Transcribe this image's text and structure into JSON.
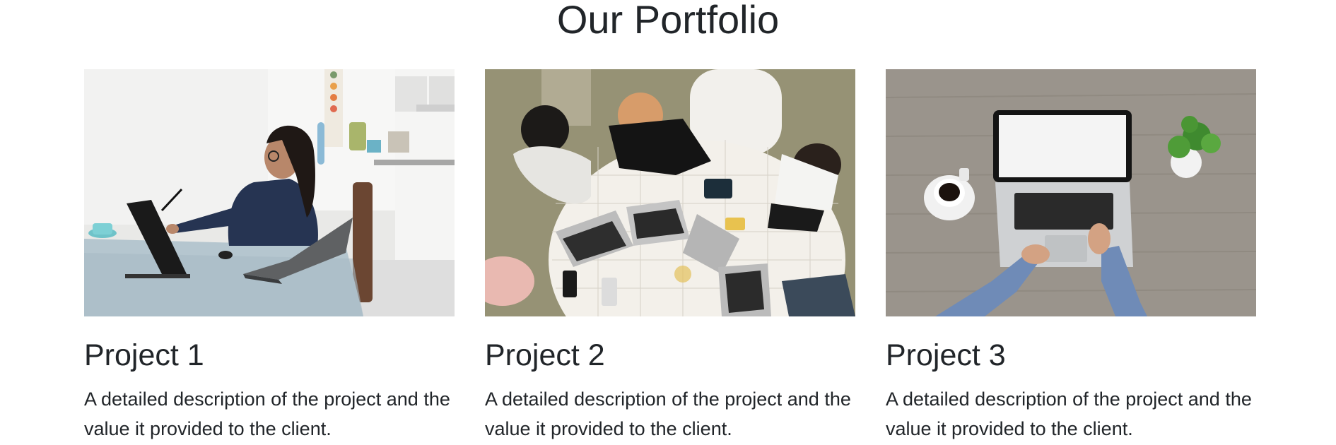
{
  "section": {
    "title": "Our Portfolio"
  },
  "projects": [
    {
      "title": "Project 1",
      "description": "A detailed description of the project and the value it provided to the client.",
      "image_icon": "woman-with-tablet-photo"
    },
    {
      "title": "Project 2",
      "description": "A detailed description of the project and the value it provided to the client.",
      "image_icon": "team-meeting-laptops-photo"
    },
    {
      "title": "Project 3",
      "description": "A detailed description of the project and the value it provided to the client.",
      "image_icon": "laptop-coffee-desk-photo"
    }
  ],
  "colors": {
    "text": "#212529",
    "background": "#ffffff"
  }
}
